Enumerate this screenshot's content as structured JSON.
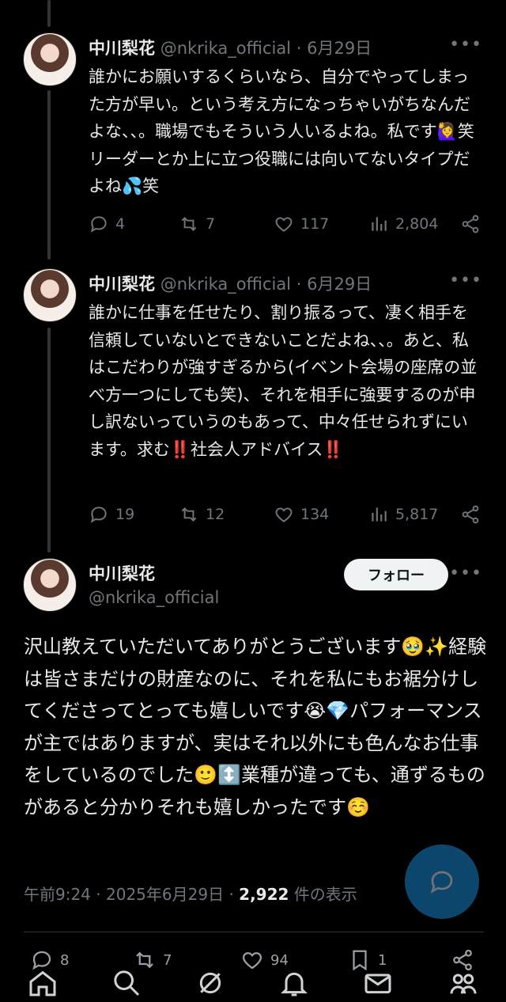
{
  "tweets": [
    {
      "name": "中川梨花",
      "handle": "@nkrika_official",
      "sep": "·",
      "date": "6月29日",
      "text": "誰かにお願いするくらいなら、自分でやってしまった方が早い。という考え方になっちゃいがちなんだよな、、。職場でもそういう人いるよね。私です🙋‍♀️笑　リーダーとか上に立つ役職には向いてないタイプだよね💦笑",
      "replies": "4",
      "reposts": "7",
      "likes": "117",
      "views": "2,804"
    },
    {
      "name": "中川梨花",
      "handle": "@nkrika_official",
      "sep": "·",
      "date": "6月29日",
      "text": "誰かに仕事を任せたり、割り振るって、凄く相手を信頼していないとできないことだよね、、。あと、私はこだわりが強すぎるから(イベント会場の座席の並べ方一つにしても笑)、それを相手に強要するのが申し訳ないっていうのもあって、中々任せられずにいます。求む‼️社会人アドバイス‼️",
      "replies": "19",
      "reposts": "12",
      "likes": "134",
      "views": "5,817"
    }
  ],
  "main_tweet": {
    "name": "中川梨花",
    "handle": "@nkrika_official",
    "follow_label": "フォロー",
    "text": "沢山教えていただいてありがとうございます🥹✨経験は皆さまだけの財産なのに、それを私にもお裾分けしてくださってとっても嬉しいです😭💎パフォーマンスが主ではありますが、実はそれ以外にも色んなお仕事をしているのでした🙂↕️業種が違っても、通ずるものがあると分かりそれも嬉しかったです☺️",
    "time": "午前9:24",
    "sep": "·",
    "date": "2025年6月29日",
    "sep2": "·",
    "views_count": "2,922",
    "views_label": "件の表示",
    "replies": "8",
    "reposts": "7",
    "likes": "94",
    "bookmarks": "1"
  },
  "icons": {
    "more": "more-icon",
    "reply": "reply-icon",
    "repost": "repost-icon",
    "like": "like-icon",
    "views": "views-icon",
    "share": "share-icon",
    "compose": "compose-icon",
    "home": "home-icon",
    "search": "search-icon",
    "grok": "grok-icon",
    "notifications": "bell-icon",
    "messages": "mail-icon",
    "communities": "communities-icon"
  },
  "colors": {
    "background": "#000000",
    "text": "#e7e9ea",
    "muted": "#71767b",
    "accent": "#1d9bf0"
  }
}
